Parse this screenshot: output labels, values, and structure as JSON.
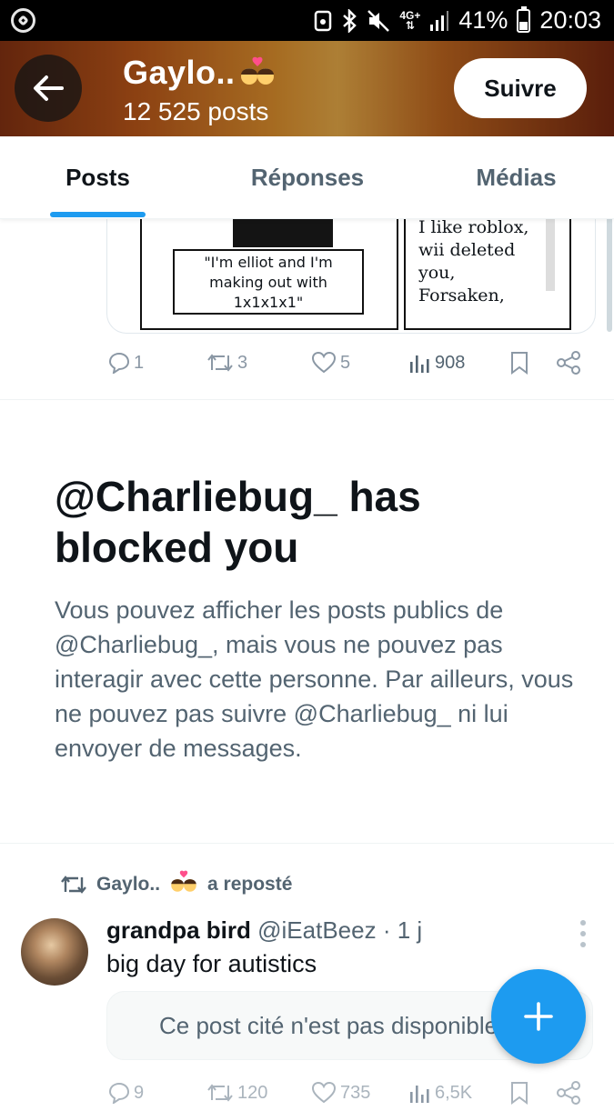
{
  "status_bar": {
    "network": "4G+",
    "battery": "41%",
    "time": "20:03"
  },
  "header": {
    "name": "Gaylo..",
    "emoji": "💏",
    "posts_count": "12 525 posts",
    "follow_label": "Suivre"
  },
  "tabs": [
    {
      "label": "Posts",
      "active": true
    },
    {
      "label": "Réponses",
      "active": false
    },
    {
      "label": "Médias",
      "active": false
    }
  ],
  "top_post": {
    "comic": {
      "left_caption": "\"I'm elliot and I'm\nmaking out with\n1x1x1x1\"",
      "right_text": "I like roblox,\nwii deleted\nyou,\nForsaken,"
    },
    "replies": "1",
    "reposts": "3",
    "likes": "5",
    "views": "908"
  },
  "blocked": {
    "title": "@Charliebug_ has blocked you",
    "body": "Vous pouvez afficher les posts publics de @Charliebug_, mais vous ne pouvez pas interagir avec cette personne. Par ailleurs, vous ne pouvez pas suivre @Charliebug_ ni lui envoyer de messages."
  },
  "repost": {
    "reposter": "Gaylo..",
    "emoji": "💏",
    "label": "a reposté",
    "author_name": "grandpa bird",
    "author_handle": "@iEatBeez",
    "separator": "·",
    "time": "1 j",
    "text": "big day for autistics",
    "quote_unavailable": "Ce post cité n'est pas disponible.",
    "replies": "9",
    "reposts": "120",
    "likes": "735",
    "views": "6,5K"
  },
  "colors": {
    "accent": "#1d9bf0",
    "text_primary": "#0f1419",
    "text_secondary": "#536471",
    "icon_gray": "#8b98a5"
  }
}
